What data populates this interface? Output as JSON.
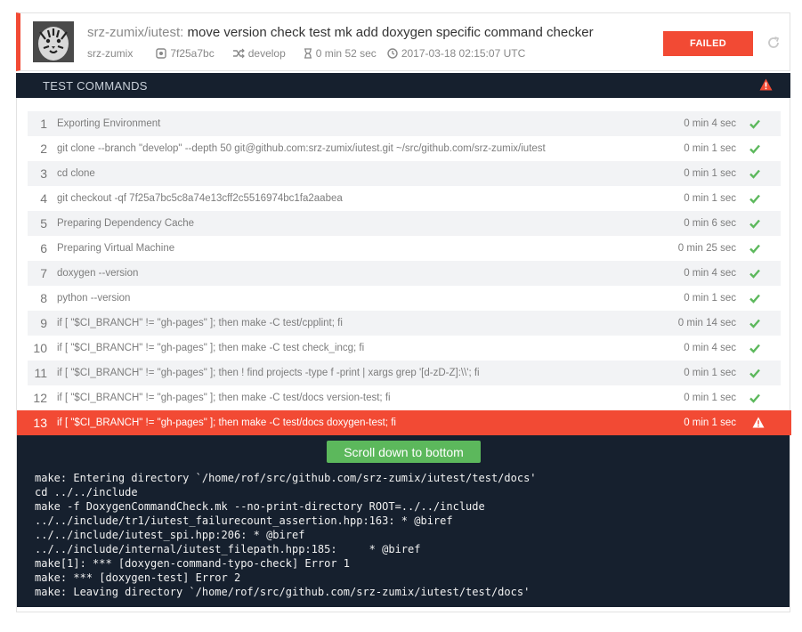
{
  "build": {
    "repo": "srz-zumix/iutest:",
    "message": "move version check test mk add doxygen specific command checker",
    "author": "srz-zumix",
    "commit": "7f25a7bc",
    "branch": "develop",
    "duration": "0 min 52 sec",
    "timestamp": "2017-03-18 02:15:07 UTC",
    "status": "FAILED",
    "status_color": "#f24a34"
  },
  "section": {
    "title": "TEST COMMANDS"
  },
  "commands": [
    {
      "num": "1",
      "text": "Exporting Environment",
      "time": "0 min 4 sec",
      "status": "success"
    },
    {
      "num": "2",
      "text": "git clone --branch \"develop\" --depth 50 git@github.com:srz-zumix/iutest.git ~/src/github.com/srz-zumix/iutest",
      "time": "0 min 1 sec",
      "status": "success"
    },
    {
      "num": "3",
      "text": "cd clone",
      "time": "0 min 1 sec",
      "status": "success"
    },
    {
      "num": "4",
      "text": "git checkout -qf 7f25a7bc5c8a74e13cff2c5516974bc1fa2aabea",
      "time": "0 min 1 sec",
      "status": "success"
    },
    {
      "num": "5",
      "text": "Preparing Dependency Cache",
      "time": "0 min 6 sec",
      "status": "success"
    },
    {
      "num": "6",
      "text": "Preparing Virtual Machine",
      "time": "0 min 25 sec",
      "status": "success"
    },
    {
      "num": "7",
      "text": "doxygen --version",
      "time": "0 min 4 sec",
      "status": "success"
    },
    {
      "num": "8",
      "text": "python --version",
      "time": "0 min 1 sec",
      "status": "success"
    },
    {
      "num": "9",
      "text": "if [ \"$CI_BRANCH\" != \"gh-pages\" ]; then make -C test/cpplint; fi",
      "time": "0 min 14 sec",
      "status": "success"
    },
    {
      "num": "10",
      "text": "if [ \"$CI_BRANCH\" != \"gh-pages\" ]; then make -C test check_incg; fi",
      "time": "0 min 4 sec",
      "status": "success"
    },
    {
      "num": "11",
      "text": "if [ \"$CI_BRANCH\" != \"gh-pages\" ]; then ! find projects -type f -print | xargs grep '[d-zD-Z]:\\\\'; fi",
      "time": "0 min 1 sec",
      "status": "success"
    },
    {
      "num": "12",
      "text": "if [ \"$CI_BRANCH\" != \"gh-pages\" ]; then make -C test/docs version-test; fi",
      "time": "0 min 1 sec",
      "status": "success"
    },
    {
      "num": "13",
      "text": "if [ \"$CI_BRANCH\" != \"gh-pages\" ]; then make -C test/docs doxygen-test; fi",
      "time": "0 min 1 sec",
      "status": "failed"
    }
  ],
  "log": {
    "scroll_button": "Scroll down to bottom",
    "lines": [
      "make: Entering directory `/home/rof/src/github.com/srz-zumix/iutest/test/docs'",
      "cd ../../include",
      "make -f DoxygenCommandCheck.mk --no-print-directory ROOT=../../include",
      "../../include/tr1/iutest_failurecount_assertion.hpp:163: * @biref",
      "../../include/iutest_spi.hpp:206: * @biref",
      "../../include/internal/iutest_filepath.hpp:185:     * @biref",
      "make[1]: *** [doxygen-command-typo-check] Error 1",
      "make: *** [doxygen-test] Error 2",
      "make: Leaving directory `/home/rof/src/github.com/srz-zumix/iutest/test/docs'"
    ]
  },
  "colors": {
    "success": "#5cb85c",
    "danger": "#f24a34",
    "dark": "#16202e"
  },
  "icons": {
    "commit": "commit-icon",
    "branch": "branch-icon",
    "duration": "hourglass-icon",
    "time": "clock-icon",
    "refresh": "refresh-icon",
    "warning": "warning-icon",
    "success": "check-icon"
  }
}
